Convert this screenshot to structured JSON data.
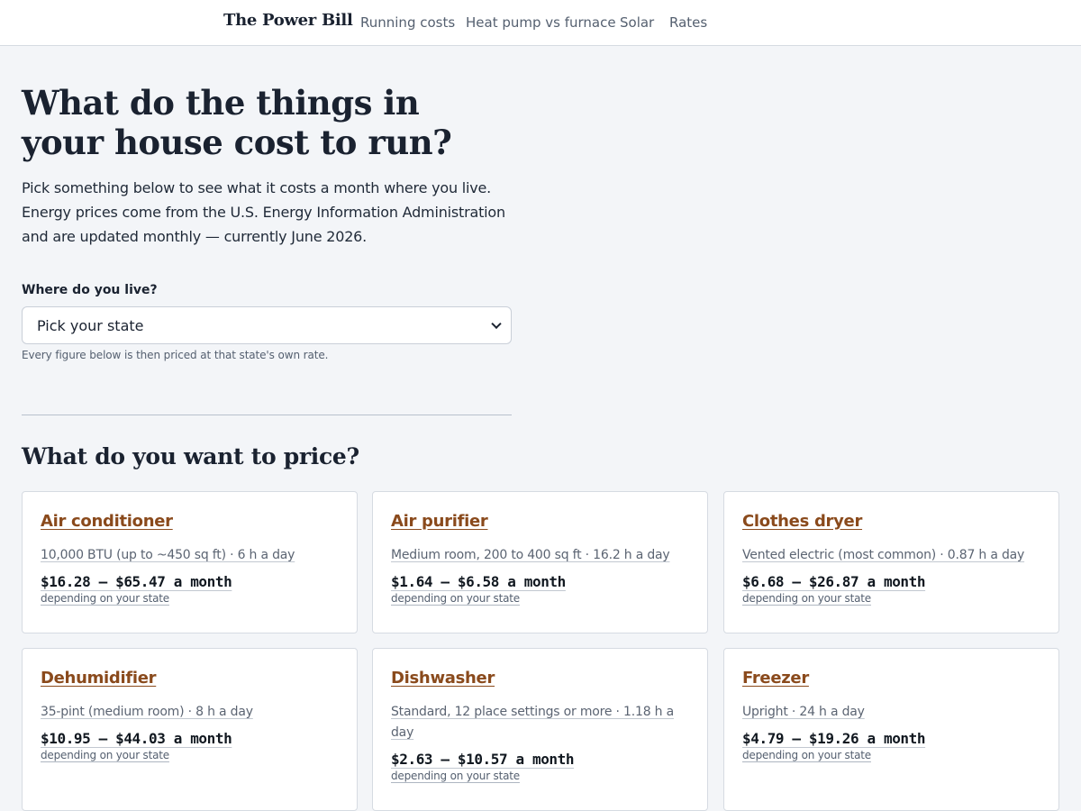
{
  "header": {
    "brand": "The Power Bill",
    "nav": [
      "Running costs",
      "Heat pump vs furnace",
      "Solar",
      "Rates"
    ]
  },
  "hero": {
    "title_line1": "What do the things in",
    "title_line2": "your house cost to run?",
    "intro_line1": "Pick something below to see what it costs a month where you live.",
    "intro_line2": "Energy prices come from the U.S. Energy Information Administration",
    "intro_line3": "and are updated monthly — currently June 2026."
  },
  "location": {
    "label": "Where do you live?",
    "selected": "Pick your state",
    "helper": "Every figure below is then priced at that state's own rate."
  },
  "section_title": "What do you want to price?",
  "cards": [
    {
      "title": "Air conditioner",
      "spec": "10,000 BTU (up to ~450 sq ft) · 6 h a day",
      "cost": "$16.28 – $65.47 a month",
      "note": "depending on your state"
    },
    {
      "title": "Air purifier",
      "spec": "Medium room, 200 to 400 sq ft · 16.2 h a day",
      "cost": "$1.64 – $6.58 a month",
      "note": "depending on your state"
    },
    {
      "title": "Clothes dryer",
      "spec": "Vented electric (most common) · 0.87 h a day",
      "cost": "$6.68 – $26.87 a month",
      "note": "depending on your state"
    },
    {
      "title": "Dehumidifier",
      "spec": "35-pint (medium room) · 8 h a day",
      "cost": "$10.95 – $44.03 a month",
      "note": "depending on your state"
    },
    {
      "title": "Dishwasher",
      "spec": "Standard, 12 place settings or more · 1.18 h a day",
      "cost": "$2.63 – $10.57 a month",
      "note": "depending on your state"
    },
    {
      "title": "Freezer",
      "spec": "Upright · 24 h a day",
      "cost": "$4.79 – $19.26 a month",
      "note": "depending on your state"
    }
  ]
}
